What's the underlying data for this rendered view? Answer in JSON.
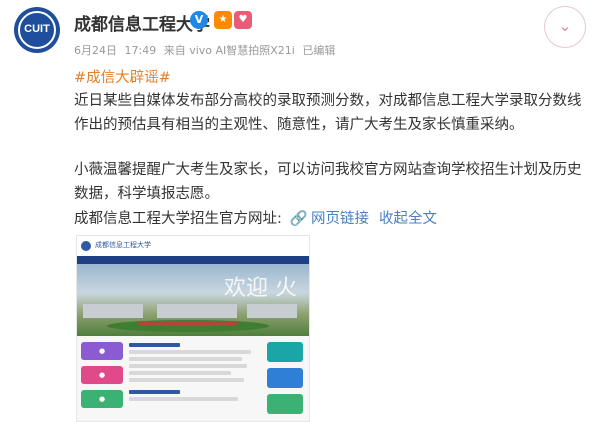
{
  "account": {
    "name": "成都信息工程大学",
    "avatar_text": "CUIT",
    "verified_icon": "verified-v-icon",
    "badges": [
      "badge-icon",
      "badge-icon"
    ]
  },
  "meta": {
    "date": "6月24日",
    "time": "17:49",
    "source": "来自 vivo AI智慧拍照X21i",
    "edited": "已编辑"
  },
  "post": {
    "hashtag": "#成信大辟谣#",
    "paragraph1": "近日某些自媒体发布部分高校的录取预测分数，对成都信息工程大学录取分数线作出的预估具有相当的主观性、随意性，请广大考生及家长慎重采纳。",
    "paragraph2": "小薇温馨提醒广大考生及家长，可以访问我校官方网站查询学校招生计划及历史数据，科学填报志愿。",
    "link_prefix": "成都信息工程大学招生官方网址:",
    "link_label": "网页链接",
    "expand_label": "收起全文"
  },
  "thumbnail": {
    "logo_text": "成都信息工程大学",
    "slogan": "欢迎 火"
  },
  "colors": {
    "link_blue": "#4a7fc1",
    "hashtag_orange": "#e47f2c",
    "brand_blue": "#1f4f9c"
  }
}
